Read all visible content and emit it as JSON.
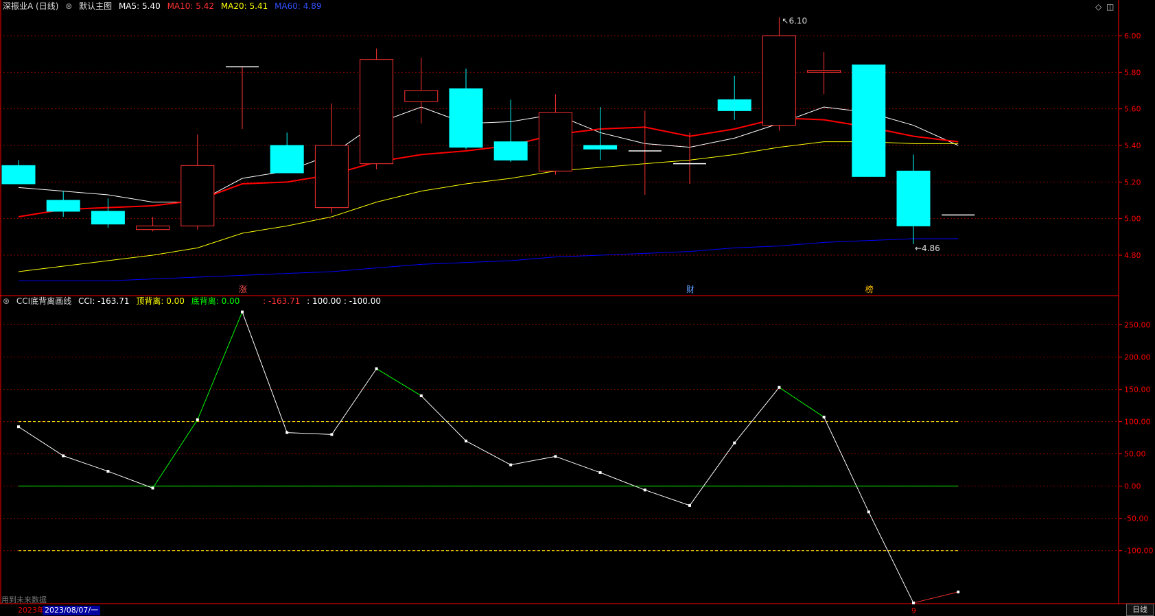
{
  "header": {
    "stock_name": "深振业A (日线)",
    "main_chart_label": "默认主图",
    "ma5": "MA5: 5.40",
    "ma10": "MA10: 5.42",
    "ma20": "MA20: 5.41",
    "ma60": "MA60: 4.89"
  },
  "indicator_header": {
    "name": "CCI底背离画线",
    "cci": "CCI: -163.71",
    "top_div": "顶背离: 0.00",
    "bottom_div": "底背离: 0.00",
    "cur": ": -163.71",
    "levels": ": 100.00 : -100.00"
  },
  "colors": {
    "up": "#ff3232",
    "down": "#00ffff",
    "ma5": "#ffffff",
    "ma10": "#ff0000",
    "ma20": "#ffff00",
    "ma60": "#0000ff",
    "grid": "#8b0000",
    "axis": "#ff0000",
    "green": "#00ff00"
  },
  "markers": [
    {
      "label": "涨",
      "color": "#ff5050",
      "index": 5
    },
    {
      "label": "财",
      "color": "#5fa0ff",
      "index": 15
    },
    {
      "label": "榜",
      "color": "#ffc000",
      "index": 19
    }
  ],
  "annotations": {
    "high": "6.10",
    "low": "4.86"
  },
  "footer": {
    "future_hint": "用到未来数据",
    "date_year": "2023年",
    "date": "2023/08/07/一",
    "month_mark": "9",
    "period_tab": "日线"
  },
  "chart_data": [
    {
      "type": "candlestick",
      "title": "深振业A (日线)",
      "ylim": [
        4.62,
        6.12
      ],
      "yticks": [
        4.8,
        5.0,
        5.2,
        5.4,
        5.6,
        5.8,
        6.0
      ],
      "grid": true,
      "candles": [
        {
          "o": 5.29,
          "h": 5.32,
          "l": 5.19,
          "c": 5.19
        },
        {
          "o": 5.1,
          "h": 5.15,
          "l": 5.01,
          "c": 5.04
        },
        {
          "o": 5.04,
          "h": 5.11,
          "l": 4.95,
          "c": 4.97
        },
        {
          "o": 4.94,
          "h": 5.01,
          "l": 4.93,
          "c": 4.96
        },
        {
          "o": 4.96,
          "h": 5.46,
          "l": 4.94,
          "c": 5.29
        },
        {
          "o": 5.83,
          "h": 5.83,
          "l": 5.49,
          "c": 5.83
        },
        {
          "o": 5.4,
          "h": 5.47,
          "l": 5.25,
          "c": 5.25
        },
        {
          "o": 5.06,
          "h": 5.63,
          "l": 5.03,
          "c": 5.4
        },
        {
          "o": 5.3,
          "h": 5.93,
          "l": 5.27,
          "c": 5.87
        },
        {
          "o": 5.64,
          "h": 5.88,
          "l": 5.52,
          "c": 5.7
        },
        {
          "o": 5.71,
          "h": 5.82,
          "l": 5.38,
          "c": 5.39
        },
        {
          "o": 5.42,
          "h": 5.65,
          "l": 5.31,
          "c": 5.32
        },
        {
          "o": 5.26,
          "h": 5.68,
          "l": 5.24,
          "c": 5.58
        },
        {
          "o": 5.4,
          "h": 5.61,
          "l": 5.32,
          "c": 5.38
        },
        {
          "o": 5.37,
          "h": 5.59,
          "l": 5.13,
          "c": 5.37
        },
        {
          "o": 5.3,
          "h": 5.47,
          "l": 5.19,
          "c": 5.3
        },
        {
          "o": 5.65,
          "h": 5.78,
          "l": 5.54,
          "c": 5.59
        },
        {
          "o": 5.51,
          "h": 6.1,
          "l": 5.48,
          "c": 6.0
        },
        {
          "o": 5.8,
          "h": 5.91,
          "l": 5.68,
          "c": 5.81
        },
        {
          "o": 5.84,
          "h": 5.84,
          "l": 5.23,
          "c": 5.23
        },
        {
          "o": 5.26,
          "h": 5.35,
          "l": 4.86,
          "c": 4.96
        },
        {
          "o": 5.02,
          "h": 5.02,
          "l": 5.02,
          "c": 5.02
        }
      ],
      "series": [
        {
          "name": "MA5",
          "values": [
            5.17,
            5.15,
            5.13,
            5.09,
            5.09,
            5.22,
            5.26,
            5.35,
            5.52,
            5.61,
            5.52,
            5.53,
            5.57,
            5.47,
            5.41,
            5.39,
            5.44,
            5.52,
            5.61,
            5.58,
            5.51,
            5.4
          ]
        },
        {
          "name": "MA10",
          "values": [
            5.01,
            5.05,
            5.06,
            5.07,
            5.1,
            5.19,
            5.2,
            5.24,
            5.31,
            5.35,
            5.37,
            5.4,
            5.46,
            5.49,
            5.5,
            5.45,
            5.49,
            5.55,
            5.54,
            5.5,
            5.45,
            5.42
          ]
        },
        {
          "name": "MA20",
          "values": [
            4.71,
            4.74,
            4.77,
            4.8,
            4.84,
            4.92,
            4.96,
            5.01,
            5.09,
            5.15,
            5.19,
            5.22,
            5.26,
            5.28,
            5.3,
            5.32,
            5.35,
            5.39,
            5.42,
            5.42,
            5.41,
            5.41
          ]
        },
        {
          "name": "MA60",
          "values": [
            4.66,
            4.66,
            4.66,
            4.67,
            4.68,
            4.69,
            4.7,
            4.71,
            4.73,
            4.75,
            4.76,
            4.77,
            4.79,
            4.8,
            4.81,
            4.82,
            4.84,
            4.85,
            4.87,
            4.88,
            4.89,
            4.89
          ]
        }
      ]
    },
    {
      "type": "line",
      "title": "CCI底背离画线",
      "ylim": [
        -180,
        275
      ],
      "yticks": [
        -100,
        -50,
        0,
        50,
        100,
        150,
        200,
        250
      ],
      "levels": [
        100,
        0,
        -100
      ],
      "series": [
        {
          "name": "CCI",
          "values": [
            92,
            47,
            23,
            -3,
            103,
            270,
            83,
            80,
            182,
            140,
            70,
            33,
            46,
            21,
            -6,
            -30,
            67,
            153,
            107,
            -40,
            -181,
            -164
          ]
        }
      ]
    }
  ]
}
